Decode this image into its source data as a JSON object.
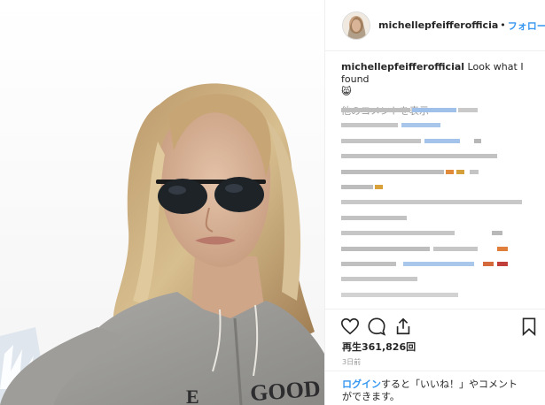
{
  "post": {
    "username": "michellepfeifferofficia",
    "separator": "•",
    "follow_label": "フォローする",
    "caption_user": "michellepfeifferofficial",
    "caption_text": " Look what I found",
    "caption_emoji": "😸",
    "more_comments_label": "他のコメントを表示",
    "views_label": "再生361,826回",
    "time_label": "3日前",
    "login_link": "ログイン",
    "login_text": "すると「いいね！」やコメント",
    "login_text2": "ができます。"
  },
  "icons": [
    "heart-icon",
    "comment-icon",
    "share-icon",
    "bookmark-icon"
  ]
}
